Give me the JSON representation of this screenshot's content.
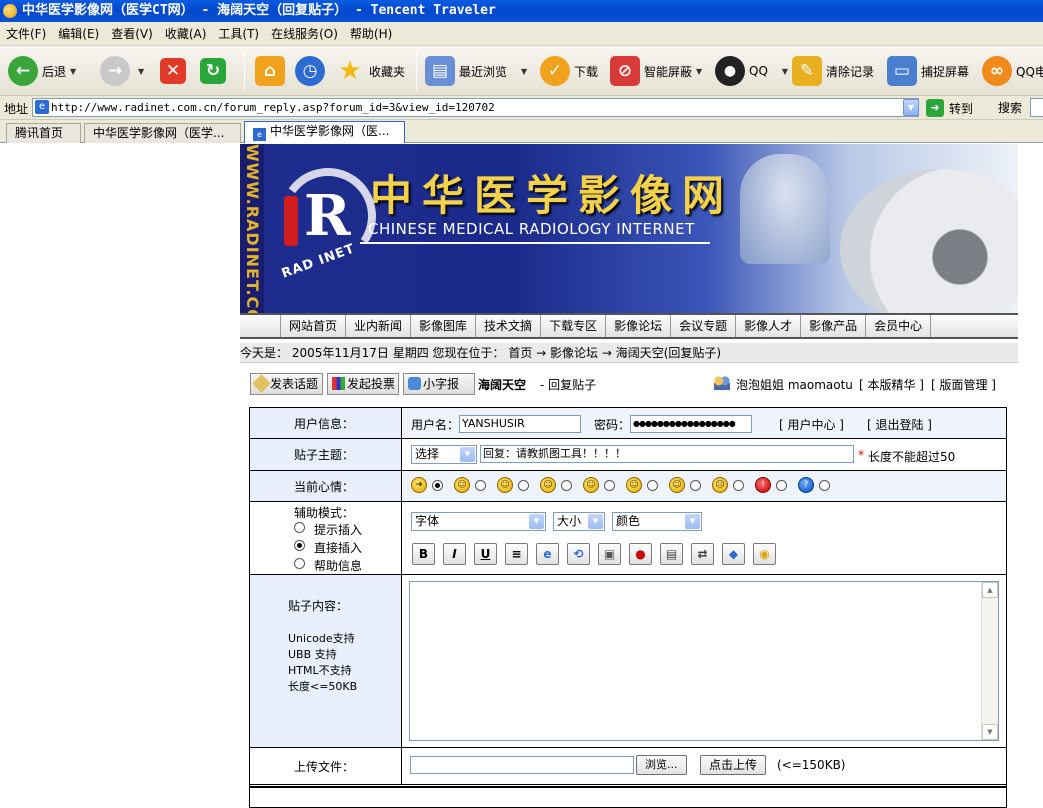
{
  "window": {
    "title": "中华医学影像网（医学CT网） - 海阔天空（回复贴子） - Tencent Traveler"
  },
  "menu": [
    "文件(F)",
    "编辑(E)",
    "查看(V)",
    "收藏(A)",
    "工具(T)",
    "在线服务(O)",
    "帮助(H)"
  ],
  "toolbar": {
    "back": "后退",
    "favorites": "收藏夹",
    "recent": "最近浏览",
    "download": "下载",
    "smart_block": "智能屏蔽",
    "qq": "QQ",
    "clear": "清除记录",
    "capture": "捕捉屏幕",
    "qqmail": "QQ电"
  },
  "address": {
    "label": "地址",
    "url": "http://www.radinet.com.cn/forum_reply.asp?forum_id=3&view_id=120702",
    "go": "转到",
    "search": "搜索"
  },
  "tabs": [
    "腾讯首页",
    "中华医学影像网（医学...",
    "中华医学影像网（医..."
  ],
  "banner": {
    "vertical": "WWW.RADINET.COM.CN",
    "logo_text": "RAD INET",
    "cn_title": "中华医学影像网",
    "en_title": "CHINESE MEDICAL RADIOLOGY INTERNET"
  },
  "nav": [
    "网站首页",
    "业内新闻",
    "影像图库",
    "技术文摘",
    "下载专区",
    "影像论坛",
    "会议专题",
    "影像人才",
    "影像产品",
    "会员中心"
  ],
  "crumb": "今天是： 2005年11月17日 星期四  您现在位于： 首页 → 影像论坛 → 海阔天空(回复贴子)",
  "actions": {
    "post": "发表话题",
    "vote": "发起投票",
    "news": "小字报",
    "board": "海阔天空",
    "mode": "- 回复贴子",
    "user": "泡泡姐姐 maomaotu",
    "elite": "[ 本版精华 ]",
    "manage": "[ 版面管理 ]"
  },
  "form": {
    "user_info_label": "用户信息：",
    "username_label": "用户名：",
    "username": "YANSHUSIR",
    "password_label": "密码：",
    "password": "●●●●●●●●●●●●●●●●●",
    "user_center": "[ 用户中心 ]",
    "logout": "[ 退出登陆 ]",
    "subject_label": "贴子主题：",
    "subject_select": "选择",
    "subject": "回复：请教抓图工具！！！！",
    "subject_note": "长度不能超过50",
    "required_mark": "*",
    "mood_label": "当前心情：",
    "assist_label": "辅助模式：",
    "assist_options": [
      "提示插入",
      "直接插入",
      "帮助信息"
    ],
    "font_select": "字体",
    "size_select": "大小",
    "color_select": "颜色",
    "format_buttons": [
      "B",
      "I",
      "U",
      "≡"
    ],
    "content_label": "贴子内容：",
    "content_notes": [
      "Unicode支持",
      "UBB 支持",
      "HTML不支持",
      "长度<=50KB"
    ],
    "upload_label": "上传文件：",
    "browse": "浏览...",
    "upload_btn": "点击上传",
    "upload_limit": "(<=150KB)"
  }
}
